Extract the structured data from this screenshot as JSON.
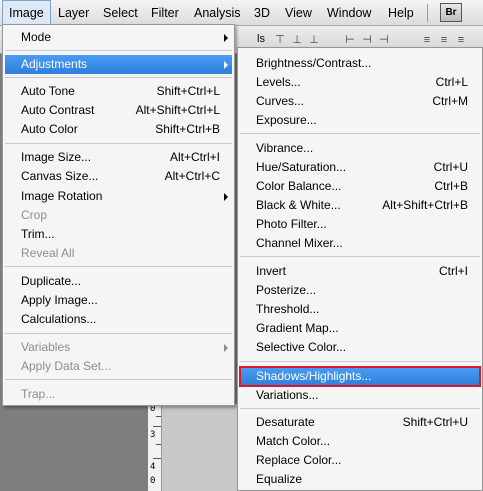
{
  "menubar": {
    "items": [
      "Image",
      "Layer",
      "Select",
      "Filter",
      "Analysis",
      "3D",
      "View",
      "Window",
      "Help"
    ],
    "bridge_badge": "Br"
  },
  "options_bar": {
    "fragment": "ls"
  },
  "ruler": {
    "labels": [
      "0",
      "3",
      "4",
      "0"
    ]
  },
  "image_menu": {
    "mode": "Mode",
    "adjustments": "Adjustments",
    "auto_tone": {
      "label": "Auto Tone",
      "shortcut": "Shift+Ctrl+L"
    },
    "auto_contrast": {
      "label": "Auto Contrast",
      "shortcut": "Alt+Shift+Ctrl+L"
    },
    "auto_color": {
      "label": "Auto Color",
      "shortcut": "Shift+Ctrl+B"
    },
    "image_size": {
      "label": "Image Size...",
      "shortcut": "Alt+Ctrl+I"
    },
    "canvas_size": {
      "label": "Canvas Size...",
      "shortcut": "Alt+Ctrl+C"
    },
    "image_rotation": "Image Rotation",
    "crop": "Crop",
    "trim": "Trim...",
    "reveal_all": "Reveal All",
    "duplicate": "Duplicate...",
    "apply_image": "Apply Image...",
    "calculations": "Calculations...",
    "variables": "Variables",
    "apply_data_set": "Apply Data Set...",
    "trap": "Trap..."
  },
  "adjustments_menu": {
    "brightness_contrast": {
      "label": "Brightness/Contrast..."
    },
    "levels": {
      "label": "Levels...",
      "shortcut": "Ctrl+L"
    },
    "curves": {
      "label": "Curves...",
      "shortcut": "Ctrl+M"
    },
    "exposure": {
      "label": "Exposure..."
    },
    "vibrance": {
      "label": "Vibrance..."
    },
    "hue_saturation": {
      "label": "Hue/Saturation...",
      "shortcut": "Ctrl+U"
    },
    "color_balance": {
      "label": "Color Balance...",
      "shortcut": "Ctrl+B"
    },
    "black_white": {
      "label": "Black & White...",
      "shortcut": "Alt+Shift+Ctrl+B"
    },
    "photo_filter": {
      "label": "Photo Filter..."
    },
    "channel_mixer": {
      "label": "Channel Mixer..."
    },
    "invert": {
      "label": "Invert",
      "shortcut": "Ctrl+I"
    },
    "posterize": {
      "label": "Posterize..."
    },
    "threshold": {
      "label": "Threshold..."
    },
    "gradient_map": {
      "label": "Gradient Map..."
    },
    "selective_color": {
      "label": "Selective Color..."
    },
    "shadows_highlights": {
      "label": "Shadows/Highlights..."
    },
    "variations": {
      "label": "Variations..."
    },
    "desaturate": {
      "label": "Desaturate",
      "shortcut": "Shift+Ctrl+U"
    },
    "match_color": {
      "label": "Match Color..."
    },
    "replace_color": {
      "label": "Replace Color..."
    },
    "equalize": {
      "label": "Equalize"
    }
  },
  "colors": {
    "highlight": "#3a8de8",
    "annotation_outline": "#e0152a",
    "menu_bg": "#f5f5f5",
    "disabled_text": "#8d8d8d"
  }
}
